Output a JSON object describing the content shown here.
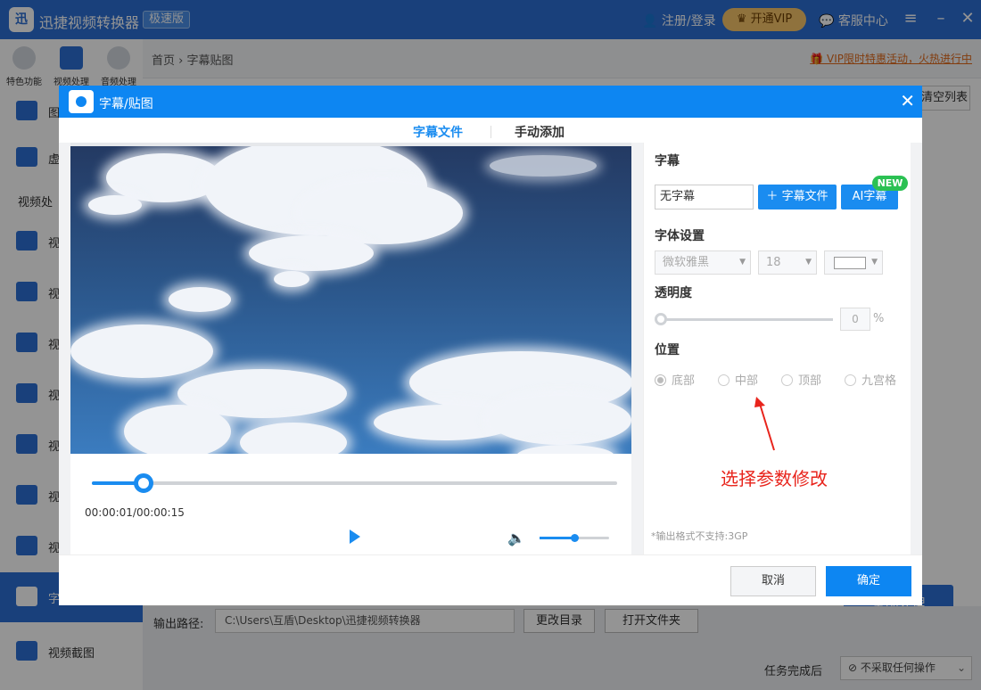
{
  "app": {
    "name": "迅捷视频转换器",
    "edition": "极速版",
    "login": "注册/登录",
    "vip": "开通VIP",
    "support": "客服中心",
    "menu_icon": "hamburger-icon",
    "minimize_icon": "minimize-icon",
    "close_icon": "close-icon"
  },
  "topnav": [
    {
      "label": "特色功能",
      "icon": "star-icon"
    },
    {
      "label": "视频处理",
      "icon": "film-icon"
    },
    {
      "label": "音频处理",
      "icon": "music-icon"
    }
  ],
  "breadcrumb": {
    "home": "首页",
    "sep": "›",
    "current": "字幕贴图"
  },
  "promo": "VIP限时特惠活动，火热进行中",
  "sidebar": {
    "partial_items": [
      {
        "label": "图",
        "icon": "image-icon"
      },
      {
        "label": "虚",
        "icon": "blur-icon"
      }
    ],
    "category": "视频处",
    "items": [
      {
        "label": "视",
        "icon": "video-icon"
      },
      {
        "label": "视",
        "icon": "user-video-icon"
      },
      {
        "label": "视",
        "icon": "film-strip-icon"
      },
      {
        "label": "视",
        "icon": "video-edit-icon"
      },
      {
        "label": "视",
        "icon": "gif-icon"
      },
      {
        "label": "视",
        "icon": "video-merge-icon"
      },
      {
        "label": "视",
        "icon": "play-circle-icon"
      },
      {
        "label": "字",
        "icon": "star-subtitle-icon"
      },
      {
        "label": "视频截图",
        "icon": "screenshot-icon"
      }
    ]
  },
  "clear_list": "清空列表",
  "process_all": "全部处理",
  "output": {
    "label": "输出路径:",
    "path": "C:\\Users\\互盾\\Desktop\\迅捷视频转换器",
    "change_dir": "更改目录",
    "open_folder": "打开文件夹"
  },
  "after_task": {
    "label": "任务完成后",
    "value": "不采取任何操作"
  },
  "dialog": {
    "title": "字幕/贴图",
    "tabs": [
      "字幕文件",
      "手动添加"
    ],
    "active_tab": 0,
    "player": {
      "time": "00:00:01/00:00:15",
      "progress": 0.0986,
      "volume": 0.5
    },
    "panel": {
      "subtitle_section": "字幕",
      "subtitle_value": "无字幕",
      "subtitle_file_btn": "字幕文件",
      "ai_btn": "AI字幕",
      "new_badge": "NEW",
      "font_section": "字体设置",
      "font_family": "微软雅黑",
      "font_size": "18",
      "font_color": "#ffffff",
      "opacity_section": "透明度",
      "opacity_value": "0",
      "opacity_unit": "%",
      "position_section": "位置",
      "positions": [
        "底部",
        "中部",
        "顶部",
        "九宫格"
      ],
      "selected_position": 0,
      "annotation": "选择参数修改",
      "annotation_color": "#e8241c",
      "note": "*输出格式不支持:3GP"
    },
    "cancel": "取消",
    "ok": "确定"
  },
  "colors": {
    "brand": "#2b6ed4",
    "dialog_accent": "#0d86f2",
    "tab_active": "#1a8cf0",
    "new_badge": "#2bc153"
  }
}
